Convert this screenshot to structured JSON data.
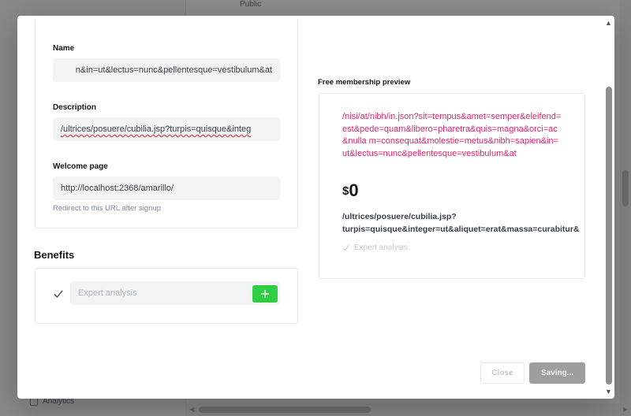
{
  "background": {
    "top_label": "Public",
    "sidebar_item": "Analytics"
  },
  "form": {
    "name_label": "Name",
    "name_value": "n&in=ut&lectus=nunc&pellentesque=vestibulum&at",
    "description_label": "Description",
    "description_value": "/ultrices/posuere/cubilia.jsp?turpis=quisque&integ",
    "welcome_label": "Welcome page",
    "welcome_value": "http://localhost:2368/amarillo/",
    "welcome_hint": "Redirect to this URL after signup"
  },
  "benefits": {
    "title": "Benefits",
    "input_placeholder": "Expert analysis"
  },
  "preview": {
    "label": "Free membership preview",
    "name": "/nisi/at/nibh/in.json?sit=tempus&amet=semper&eleifend=est&pede=quam&libero=pharetra&quis=magna&orci=ac&nulla m=consequat&molestie=metus&nibh=sapien&in=ut&lectus=nunc&pellentesque=vestibulum&at",
    "currency": "$",
    "amount": "0",
    "description_line1": "/ultrices/posuere/cubilia.jsp?",
    "description_line2": "turpis=quisque&integer=ut&aliquet=erat&massa=curabitur&",
    "benefit": "Expert analysis"
  },
  "actions": {
    "close_label": "Close",
    "save_label": "Saving..."
  },
  "colors": {
    "accent_pink": "#e5226b",
    "add_green": "#30cf43",
    "saving_gray": "#9e9e9e"
  },
  "icons": [
    "check-icon",
    "plus-icon",
    "arrow-up-icon",
    "arrow-down-icon"
  ]
}
